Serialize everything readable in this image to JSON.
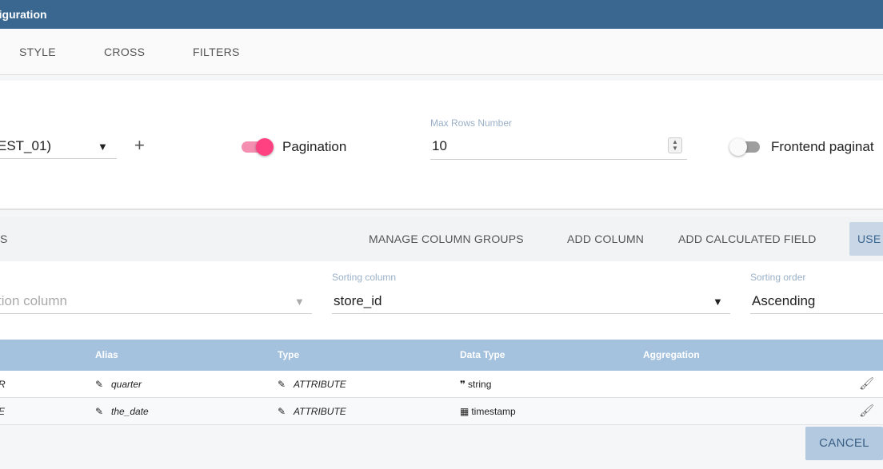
{
  "window": {
    "title": "figuration"
  },
  "tabs": [
    {
      "label": "STYLE"
    },
    {
      "label": "CROSS"
    },
    {
      "label": "FILTERS"
    }
  ],
  "dataset": {
    "selected": "EST_01)",
    "add_label": "+"
  },
  "pagination": {
    "label": "Pagination",
    "enabled": true
  },
  "max_rows": {
    "label": "Max Rows Number",
    "value": "10"
  },
  "frontend_pagination": {
    "label": "Frontend paginat",
    "enabled": false
  },
  "columns_toolbar": {
    "section_title": "S",
    "buttons": [
      {
        "label": "MANAGE COLUMN GROUPS"
      },
      {
        "label": "ADD COLUMN"
      },
      {
        "label": "ADD CALCULATED FIELD"
      },
      {
        "label": "USE"
      }
    ]
  },
  "filters": {
    "aggregation_column": {
      "placeholder": "tion column"
    },
    "sorting_column": {
      "label": "Sorting column",
      "value": "store_id"
    },
    "sorting_order": {
      "label": "Sorting order",
      "value": "Ascending"
    }
  },
  "grid": {
    "headers": [
      "Alias",
      "Type",
      "Data Type",
      "Aggregation"
    ],
    "rows": [
      {
        "name": "R",
        "alias": "quarter",
        "type": "ATTRIBUTE",
        "data_type": "string",
        "data_type_icon": "quote-icon"
      },
      {
        "name": "E",
        "alias": "the_date",
        "type": "ATTRIBUTE",
        "data_type": "timestamp",
        "data_type_icon": "calendar-icon"
      }
    ]
  },
  "footer": {
    "cancel_label": "CANCEL"
  },
  "colors": {
    "titlebar": "#3a6790",
    "accent_pink": "#ff4081",
    "grid_header": "#a4c1de",
    "button_blue": "#b3c9df"
  }
}
